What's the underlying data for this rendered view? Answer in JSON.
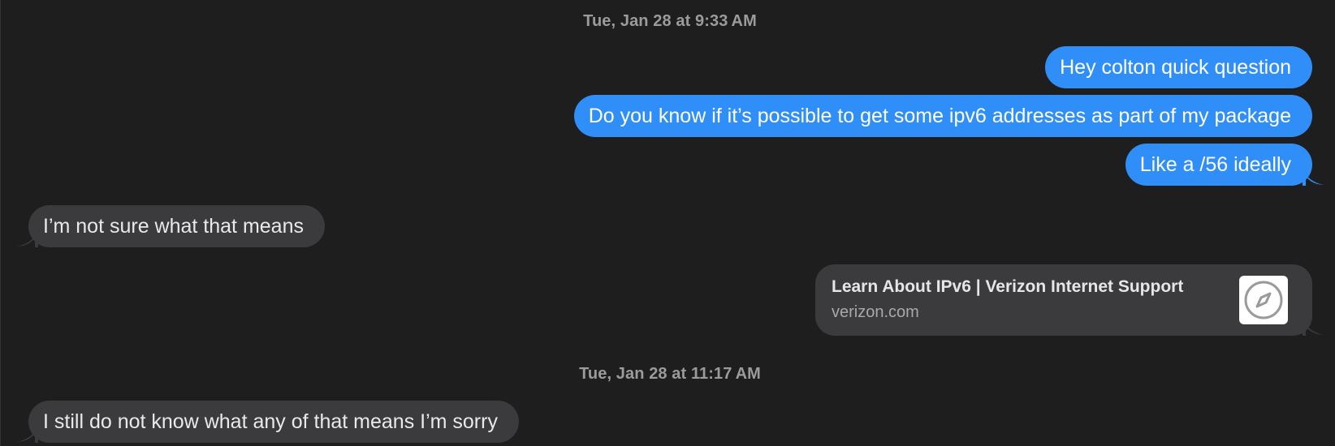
{
  "timestamps": [
    "Tue, Jan 28 at 9:33 AM",
    "Tue, Jan 28 at 11:17 AM"
  ],
  "messages": [
    {
      "direction": "outgoing",
      "text": "Hey colton quick question"
    },
    {
      "direction": "outgoing",
      "text": "Do you know if it’s possible to get some ipv6 addresses as part of my package"
    },
    {
      "direction": "outgoing",
      "text": "Like a /56 ideally"
    },
    {
      "direction": "incoming",
      "text": "I’m not sure what that means"
    },
    {
      "direction": "incoming",
      "text": "I still do not know what any of that means I’m sorry"
    }
  ],
  "link_preview": {
    "title": "Learn About IPv6 | Verizon Internet Support",
    "domain": "verizon.com",
    "icon": "safari-compass-icon"
  },
  "colors": {
    "background": "#1e1e1e",
    "outgoing_bubble": "#2f8ef7",
    "incoming_bubble": "#3b3b3d",
    "timestamp_text": "#9b9b9b"
  }
}
